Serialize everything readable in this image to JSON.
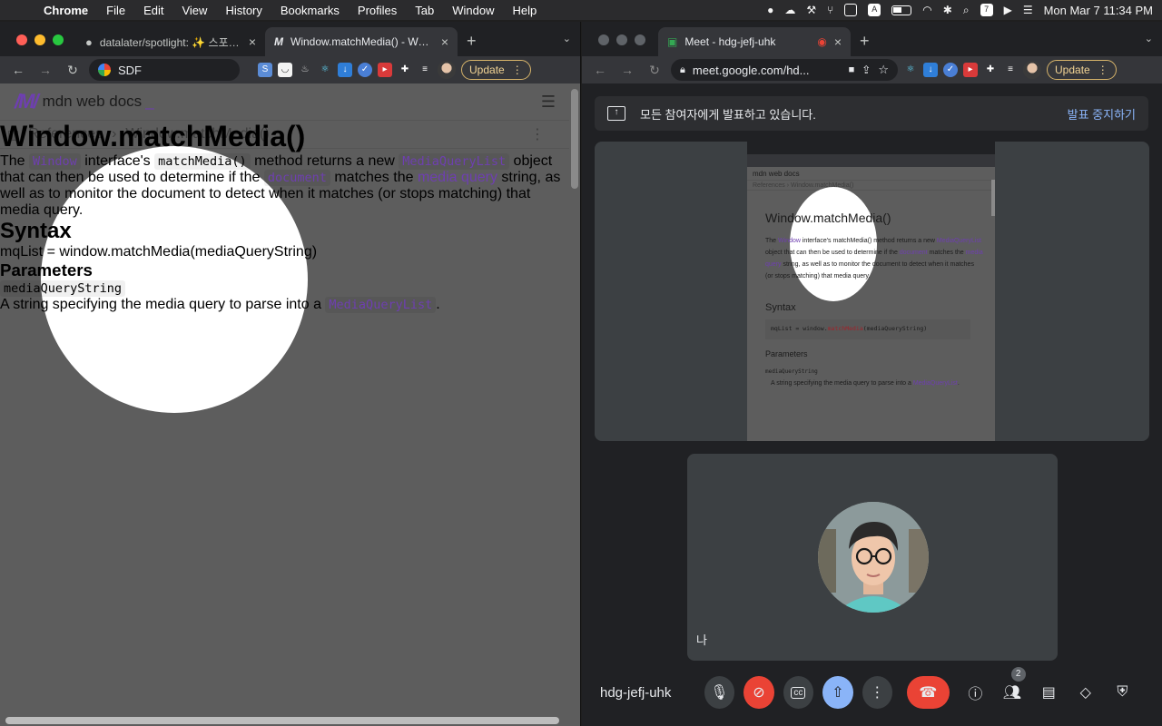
{
  "menubar": {
    "items": [
      "Chrome",
      "File",
      "Edit",
      "View",
      "History",
      "Bookmarks",
      "Profiles",
      "Tab",
      "Window",
      "Help"
    ],
    "datetime": "Mon Mar 7  11:34 PM",
    "tray_box_a": "A",
    "tray_box_7": "7"
  },
  "left": {
    "tabs": [
      {
        "title": "datalater/spotlight: ✨ 스포트라이",
        "icon": "github-icon"
      },
      {
        "title": "Window.matchMedia() - Web A",
        "icon": "mdn-icon"
      }
    ],
    "omnibox_text": "SDF",
    "update_label": "Update",
    "mdn": {
      "logo_text": "mdn web docs",
      "breadcrumb_parent": "References",
      "breadcrumb_current": "Window.matchMedia()",
      "title": "Window.matchMedia()",
      "intro": {
        "t1": "The ",
        "c1": "Window",
        "t2": " interface's ",
        "c2": "matchMedia()",
        "t3": " method returns a new ",
        "c3": "MediaQueryList",
        "t4": " object that can then be used to determine if the ",
        "c4": "document",
        "t5": " matches the ",
        "l1": "media query",
        "t6": " string, as well as to monitor the document to detect when it matches (or stops matching) that media query."
      },
      "syntax_heading": "Syntax",
      "code": {
        "pre": "mqList = window.",
        "fn": "matchMedia",
        "post": "(mediaQueryString)"
      },
      "params_heading": "Parameters",
      "param_name": "mediaQueryString",
      "param_desc_pre": "A string specifying the media query to parse into a ",
      "param_desc_code": "MediaQueryList",
      "param_desc_post": "."
    }
  },
  "right": {
    "tab_title": "Meet - hdg-jefj-uhk",
    "url": "meet.google.com/hd...",
    "update_label": "Update",
    "banner_text": "모든 참여자에게 발표하고 있습니다.",
    "banner_stop": "발표 중지하기",
    "self_name": "나",
    "meeting_code": "hdg-jefj-uhk",
    "participant_count": "2"
  }
}
